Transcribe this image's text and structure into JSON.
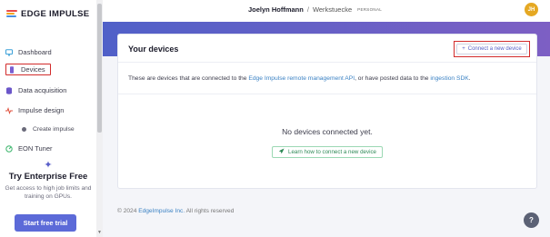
{
  "brand": {
    "name": "EDGE IMPULSE"
  },
  "nav": {
    "dashboard": "Dashboard",
    "devices": "Devices",
    "data_acquisition": "Data acquisition",
    "impulse_design": "Impulse design",
    "create_impulse": "Create impulse",
    "eon_tuner": "EON Tuner"
  },
  "promo": {
    "title": "Try Enterprise Free",
    "subtitle": "Get access to high job limits and training on GPUs.",
    "button": "Start free trial"
  },
  "topbar": {
    "user": "Joelyn Hoffmann",
    "separator": "/",
    "project": "Werkstuecke",
    "badge": "PERSONAL",
    "avatar_initials": "JH"
  },
  "devices_card": {
    "title": "Your devices",
    "connect_button": "Connect a new device",
    "description_prefix": "These are devices that are connected to the ",
    "description_link1": "Edge Impulse remote management API",
    "description_middle": ", or have posted data to the ",
    "description_link2": "ingestion SDK",
    "description_suffix": ".",
    "empty_text": "No devices connected yet.",
    "learn_button": "Learn how to connect a new device"
  },
  "footer": {
    "prefix": "© 2024 ",
    "company": "EdgeImpulse Inc.",
    "suffix": " All rights reserved"
  },
  "colors": {
    "accent": "#5c6ad8",
    "highlight": "#d22b2b",
    "success": "#2f8a57"
  }
}
